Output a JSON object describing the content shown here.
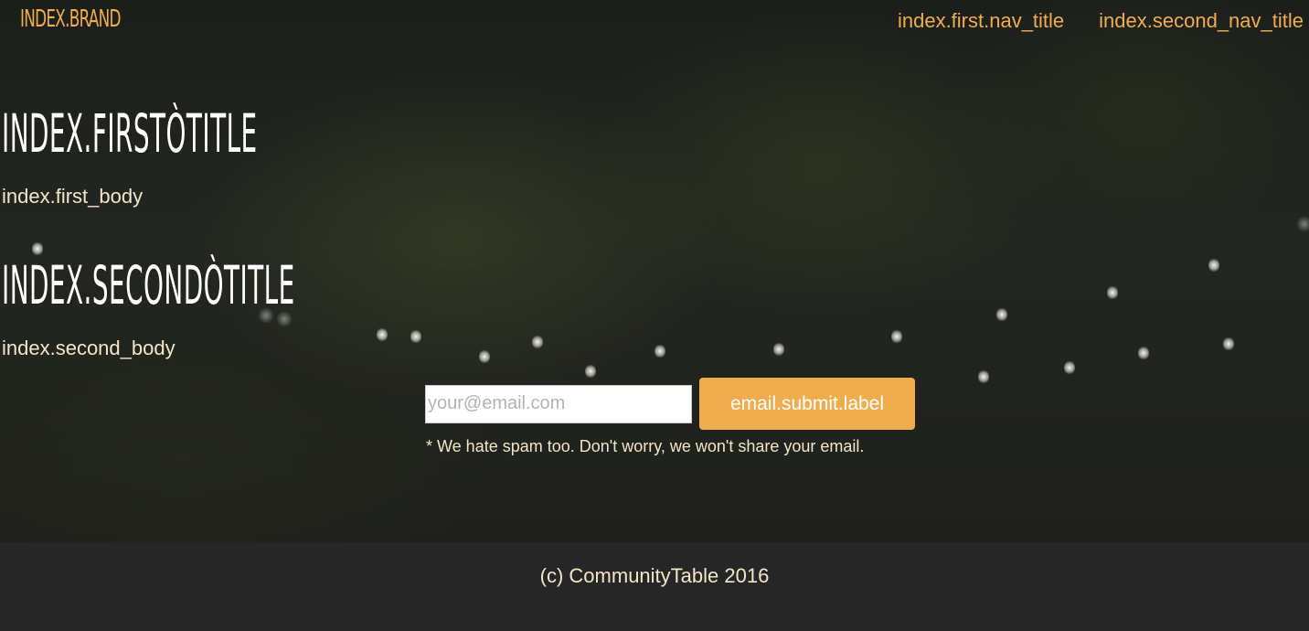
{
  "header": {
    "brand": "INDEX.BRAND",
    "nav": [
      {
        "label": "index.first.nav_title"
      },
      {
        "label": "index.second_nav_title"
      }
    ]
  },
  "sections": [
    {
      "title": "INDEX.FIRSTÒTITLE",
      "body": "index.first_body"
    },
    {
      "title": "INDEX.SECONDÒTITLE",
      "body": "index.second_body"
    }
  ],
  "email": {
    "placeholder": "your@email.com",
    "value": "",
    "submit_label": "email.submit.label",
    "disclaimer": "* We hate spam too. Don't worry, we won't share your email."
  },
  "footer": {
    "copyright": "(c) CommunityTable 2016"
  },
  "colors": {
    "accent": "#f0ad4e",
    "footer_bg": "#262626",
    "body_text": "#f3e6c8"
  }
}
